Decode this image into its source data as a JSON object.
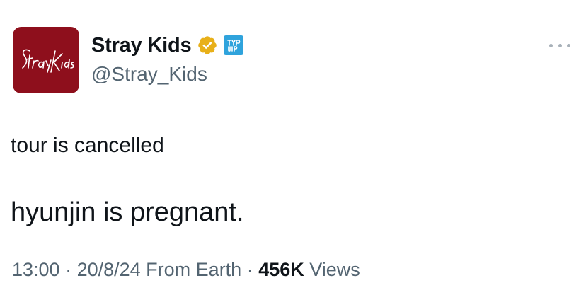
{
  "author": {
    "display_name": "Stray Kids",
    "handle": "@Stray_Kids",
    "avatar_text": "StrayKids",
    "affiliate_badge_text": "JYP",
    "verified_badge_color": "#e8b019",
    "avatar_color": "#8e0f1c",
    "affiliate_badge_color": "#2fa3dc"
  },
  "menu": {
    "icon": "more-horizontal-icon"
  },
  "tweet": {
    "line_1": "tour is cancelled",
    "line_2": "hyunjin is pregnant."
  },
  "meta": {
    "time": "13:00",
    "separator_1": " · ",
    "date": "20/8/24",
    "source": " From Earth",
    "separator_2": " · ",
    "views_count": "456K",
    "views_label": " Views"
  }
}
